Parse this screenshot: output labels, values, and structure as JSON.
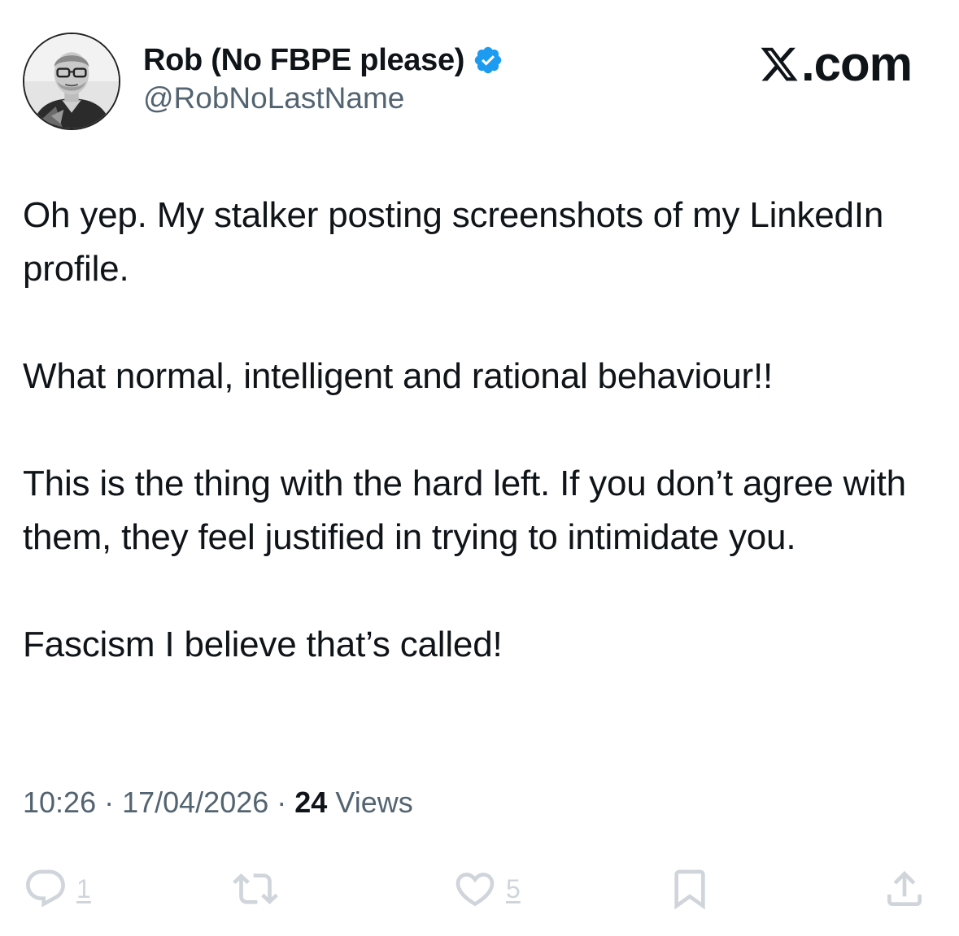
{
  "author": {
    "display_name": "Rob (No FBPE please)",
    "handle": "@RobNoLastName",
    "verified": true,
    "verified_color": "#1d9bf0",
    "avatar_icon": "profile-photo"
  },
  "site_label": ".com",
  "site_logo_icon": "x-logo",
  "tweet": {
    "paragraphs": [
      "Oh yep. My stalker posting screenshots of my LinkedIn profile.",
      "What normal, intelligent and rational behaviour!!",
      "This is the thing with the hard left. If you don’t agree with them, they feel justified in trying to intimidate you.",
      "Fascism I believe that’s called!"
    ]
  },
  "meta": {
    "time": "10:26",
    "separator": "·",
    "date": "17/04/2026",
    "views_count": "24",
    "views_label": "Views"
  },
  "actions": {
    "reply": {
      "icon": "reply-icon",
      "count": "1"
    },
    "repost": {
      "icon": "repost-icon",
      "count": ""
    },
    "like": {
      "icon": "heart-icon",
      "count": "5"
    },
    "bookmark": {
      "icon": "bookmark-icon"
    },
    "share": {
      "icon": "share-icon"
    }
  },
  "colors": {
    "text_primary": "#0f1419",
    "text_secondary": "#536471",
    "icon_muted": "#cfd5da"
  }
}
